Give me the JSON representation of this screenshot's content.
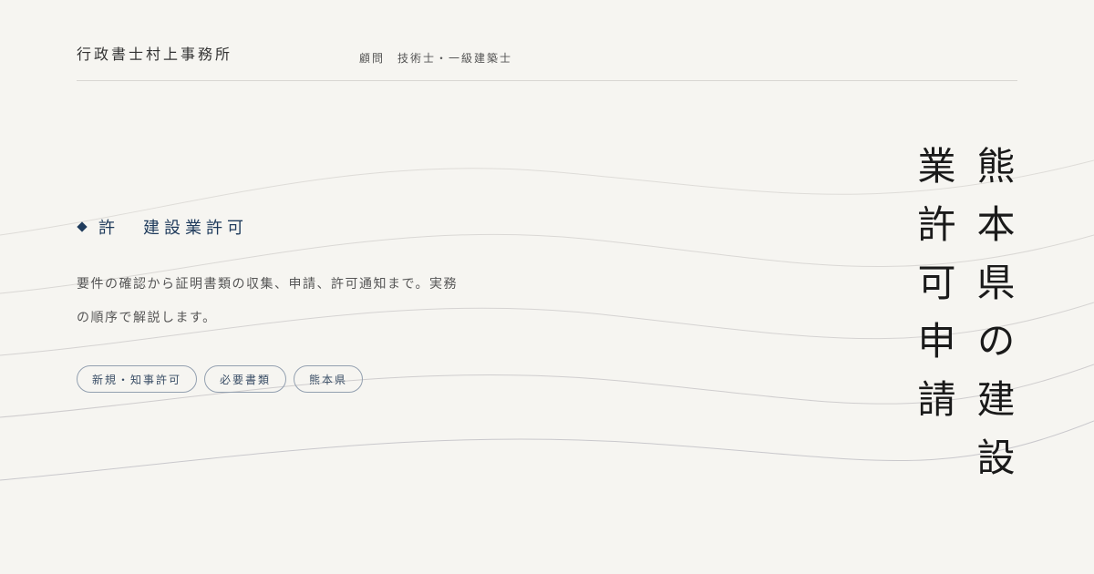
{
  "header": {
    "office_name": "行政書士村上事務所",
    "advisor": "顧問　技術士・一級建築士"
  },
  "section": {
    "prefix": "許",
    "title": "建設業許可"
  },
  "description": {
    "line1": "要件の確認から証明書類の収集、申請、許可通知まで。実務",
    "line2": "の順序で解説します。"
  },
  "tags": [
    "新規・知事許可",
    "必要書類",
    "熊本県"
  ],
  "vertical_title": {
    "column1": "熊本県の建設",
    "column2": "業許可申請"
  },
  "colors": {
    "background": "#f6f5f1",
    "accent": "#1f3b5c",
    "tag_border": "#93a0b0",
    "wave": "#c9c8cc"
  },
  "icons": {
    "heading_marker": "diamond-icon"
  }
}
